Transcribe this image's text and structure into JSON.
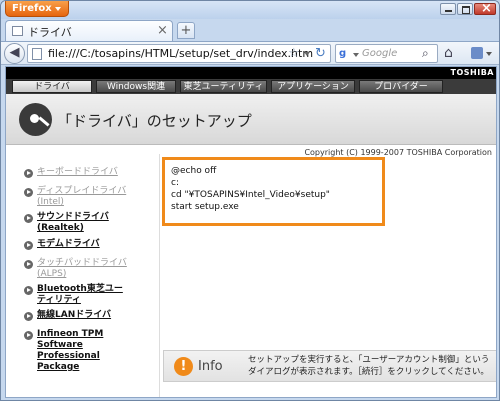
{
  "browser": {
    "app_button": "Firefox",
    "tab": {
      "title": "ドライバ",
      "close": "×"
    },
    "new_tab": "+",
    "url": "file:///C:/tosapins/HTML/setup/set_drv/index.htm",
    "search_placeholder": "Google"
  },
  "site": {
    "brand": "TOSHIBA",
    "menu": [
      {
        "label": "ドライバ",
        "active": true
      },
      {
        "label": "Windows関連",
        "active": false
      },
      {
        "label": "東芝ユーティリティ",
        "active": false
      },
      {
        "label": "アプリケーション",
        "active": false
      },
      {
        "label": "プロバイダー",
        "active": false
      }
    ],
    "page_title": "「ドライバ」のセットアップ",
    "copyright": "Copyright (C) 1999-2007 TOSHIBA Corporation"
  },
  "sidebar": {
    "items": [
      {
        "label": "キーボードドライバ",
        "enabled": false
      },
      {
        "label": "ディスプレイドライバ\n(Intel)",
        "enabled": false
      },
      {
        "label": "サウンドドライバ\n(Realtek)",
        "enabled": true
      },
      {
        "label": "モデムドライバ",
        "enabled": true
      },
      {
        "label": "タッチパッドドライバ\n(ALPS)",
        "enabled": false
      },
      {
        "label": "Bluetooth東芝ユー\nティリティ",
        "enabled": true
      },
      {
        "label": "無線LANドライバ",
        "enabled": true
      },
      {
        "label": "Infineon TPM\nSoftware\nProfessional\nPackage",
        "enabled": true
      }
    ]
  },
  "code": {
    "lines": [
      "@echo off",
      "c:",
      "cd \"¥TOSAPINS¥Intel_Video¥setup\"",
      "start setup.exe"
    ]
  },
  "info": {
    "icon": "!",
    "label": "Info",
    "text": "セットアップを実行すると、「ユーザーアカウント制御」という\nダイアログが表示されます。［続行］をクリックしてください。"
  },
  "colors": {
    "accent_orange": "#f08a1a",
    "firefox_orange": "#e6650e",
    "menu_dark": "#3b3b3b"
  }
}
